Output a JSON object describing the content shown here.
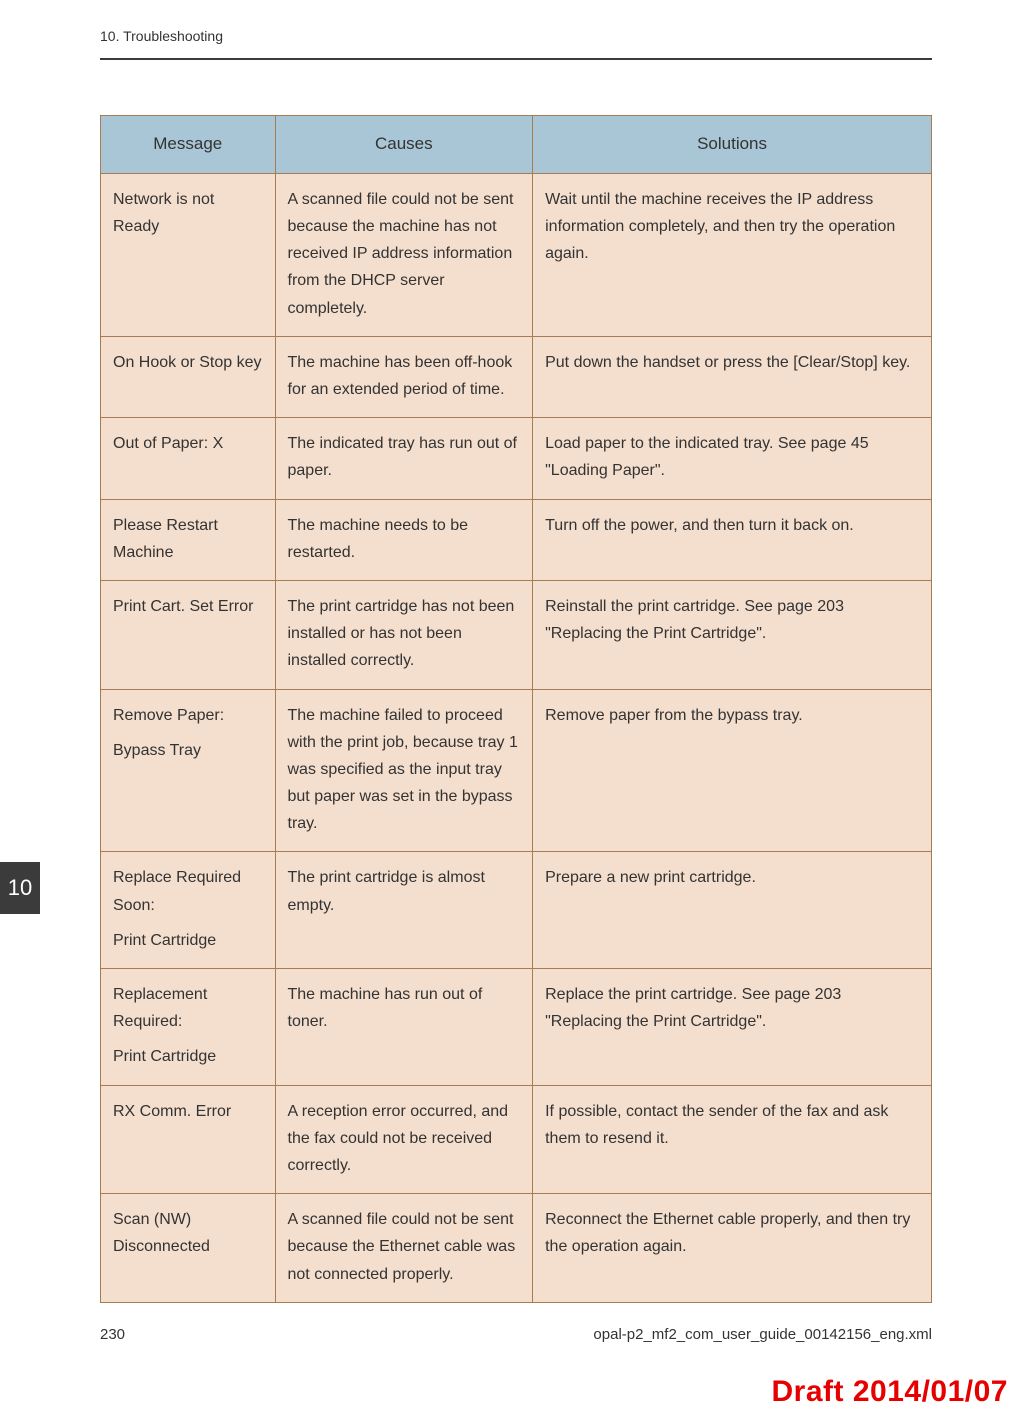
{
  "header": {
    "breadcrumb": "10. Troubleshooting"
  },
  "sideTab": "10",
  "table": {
    "headers": {
      "message": "Message",
      "causes": "Causes",
      "solutions": "Solutions"
    },
    "rows": [
      {
        "message": [
          "Network is not Ready"
        ],
        "causes": "A scanned file could not be sent because the machine has not received IP address information from the DHCP server completely.",
        "solutions": "Wait until the machine receives the IP address information completely, and then try the operation again."
      },
      {
        "message": [
          "On Hook or Stop key"
        ],
        "causes": "The machine has been off-hook for an extended period of time.",
        "solutions": "Put down the handset or press the [Clear/Stop] key."
      },
      {
        "message": [
          "Out of Paper: X"
        ],
        "causes": "The indicated tray has run out of paper.",
        "solutions": "Load paper to the indicated tray. See page 45 \"Loading Paper\"."
      },
      {
        "message": [
          "Please Restart Machine"
        ],
        "causes": "The machine needs to be restarted.",
        "solutions": "Turn off the power, and then turn it back on."
      },
      {
        "message": [
          "Print Cart. Set Error"
        ],
        "causes": "The print cartridge has not been installed or has not been installed correctly.",
        "solutions": "Reinstall the print cartridge. See page 203 \"Replacing the Print Cartridge\"."
      },
      {
        "message": [
          "Remove Paper:",
          "Bypass Tray"
        ],
        "causes": "The machine failed to proceed with the print job, because tray 1 was specified as the input tray but paper was set in the bypass tray.",
        "solutions": "Remove paper from the bypass tray."
      },
      {
        "message": [
          "Replace Required Soon:",
          "Print Cartridge"
        ],
        "causes": "The print cartridge is almost empty.",
        "solutions": "Prepare a new print cartridge."
      },
      {
        "message": [
          "Replacement Required:",
          "Print Cartridge"
        ],
        "causes": "The machine has run out of toner.",
        "solutions": "Replace the print cartridge. See page 203 \"Replacing the Print Cartridge\"."
      },
      {
        "message": [
          "RX Comm. Error"
        ],
        "causes": "A reception error occurred, and the fax could not be received correctly.",
        "solutions": "If possible, contact the sender of the fax and ask them to resend it."
      },
      {
        "message": [
          "Scan (NW) Disconnected"
        ],
        "causes": "A scanned file could not be sent because the Ethernet cable was not connected properly.",
        "solutions": "Reconnect the Ethernet cable properly, and then try the operation again."
      }
    ]
  },
  "footer": {
    "pageNumber": "230",
    "fileRef": "opal-p2_mf2_com_user_guide_00142156_eng.xml"
  },
  "draftStamp": "Draft 2014/01/07"
}
